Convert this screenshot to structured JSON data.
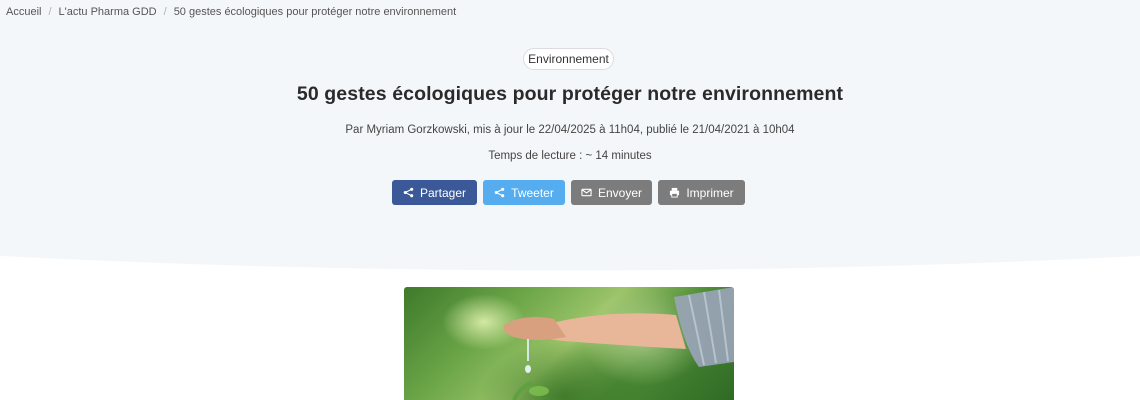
{
  "breadcrumb": {
    "items": [
      "Accueil",
      "L'actu Pharma GDD",
      "50 gestes écologiques pour protéger notre environnement"
    ],
    "separator": "/"
  },
  "article": {
    "category": "Environnement",
    "title": "50 gestes écologiques pour protéger notre environnement",
    "meta": "Par Myriam Gorzkowski, mis à jour le 22/04/2025 à 11h04, publié le 21/04/2021 à 10h04",
    "reading_time": "Temps de lecture : ~ 14 minutes"
  },
  "share": {
    "share_label": "Partager",
    "tweet_label": "Tweeter",
    "email_label": "Envoyer",
    "print_label": "Imprimer"
  },
  "colors": {
    "hero_bg": "#f4f7fa",
    "share": "#3b5998",
    "tweet": "#55acee",
    "neutral": "#7c7c7c"
  },
  "icons": {
    "share": "share-icon",
    "tweet": "share-icon",
    "email": "envelope-icon",
    "print": "printer-icon"
  }
}
